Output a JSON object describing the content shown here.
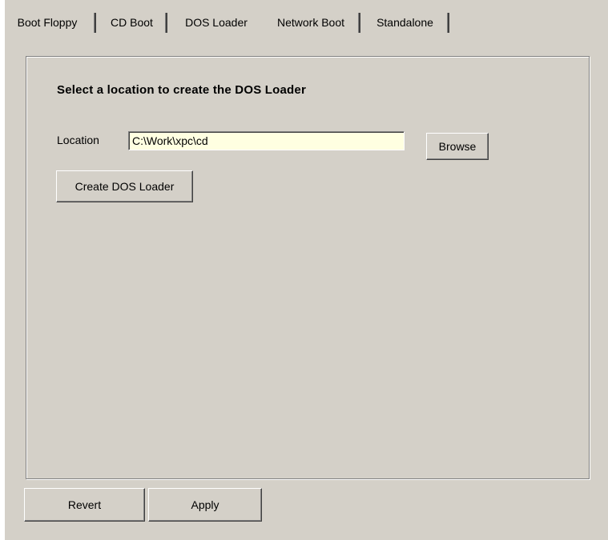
{
  "tabs": [
    {
      "label": "Boot Floppy",
      "active": false
    },
    {
      "label": "CD Boot",
      "active": false
    },
    {
      "label": "DOS Loader",
      "active": true
    },
    {
      "label": "Network Boot",
      "active": false
    },
    {
      "label": "Standalone",
      "active": false
    }
  ],
  "panel": {
    "heading": "Select a location to create the DOS Loader",
    "location_label": "Location",
    "location_value": "C:\\Work\\xpc\\cd",
    "browse_label": "Browse",
    "create_label": "Create DOS Loader"
  },
  "footer": {
    "revert_label": "Revert",
    "apply_label": "Apply"
  },
  "colors": {
    "window_bg": "#d4d0c8",
    "input_bg": "#ffffe1"
  }
}
